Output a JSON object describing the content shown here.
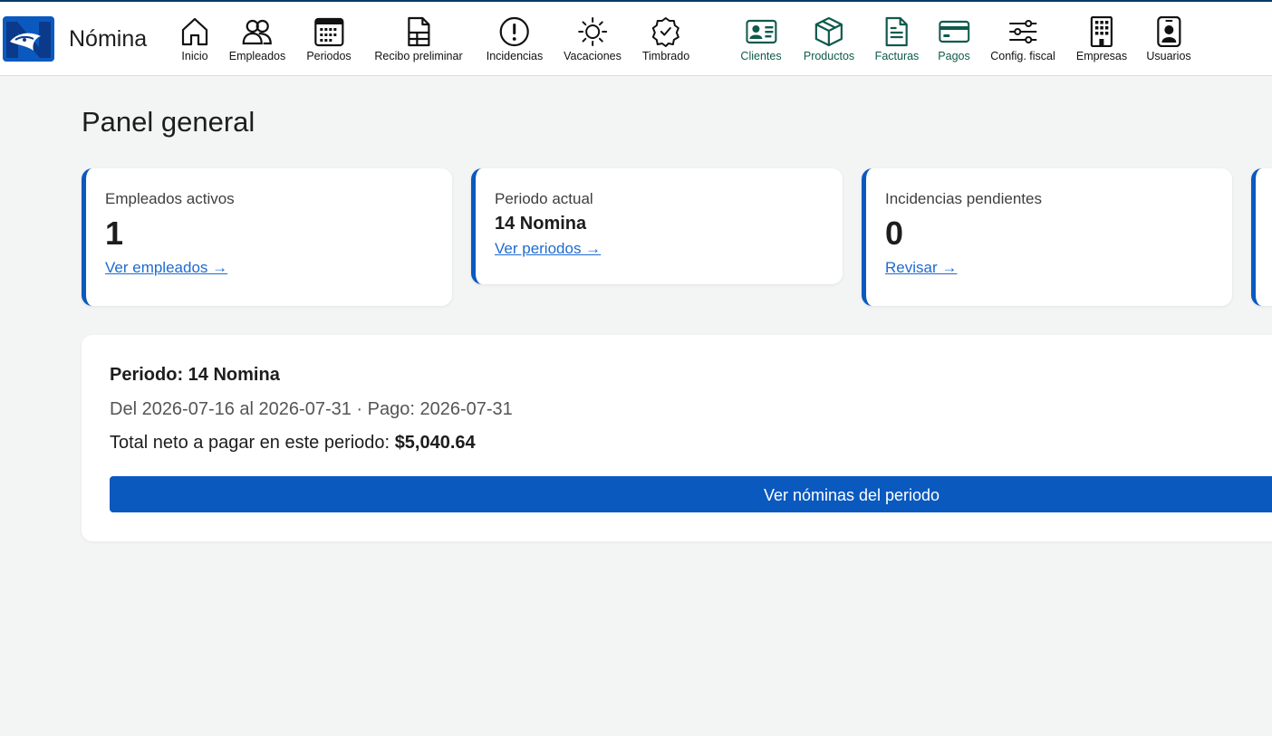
{
  "header": {
    "brand": "Nómina",
    "nav": [
      {
        "label": "Inicio",
        "icon": "home-icon"
      },
      {
        "label": "Empleados",
        "icon": "people-icon"
      },
      {
        "label": "Periodos",
        "icon": "calendar-icon"
      },
      {
        "label": "Recibo preliminar",
        "icon": "document-table-icon"
      },
      {
        "label": "Incidencias",
        "icon": "exclamation-circle-icon"
      },
      {
        "label": "Vacaciones",
        "icon": "sun-icon"
      },
      {
        "label": "Timbrado",
        "icon": "badge-check-icon"
      },
      {
        "label": "Clientes",
        "icon": "id-card-icon"
      },
      {
        "label": "Productos",
        "icon": "box-icon"
      },
      {
        "label": "Facturas",
        "icon": "invoice-icon"
      },
      {
        "label": "Pagos",
        "icon": "credit-card-icon"
      },
      {
        "label": "Config. fiscal",
        "icon": "sliders-icon"
      },
      {
        "label": "Empresas",
        "icon": "building-icon"
      },
      {
        "label": "Usuarios",
        "icon": "user-badge-icon"
      }
    ]
  },
  "page": {
    "title": "Panel general"
  },
  "cards": {
    "employees": {
      "label": "Empleados activos",
      "value": "1",
      "link": "Ver empleados →"
    },
    "period": {
      "label": "Periodo actual",
      "value": "14 Nomina",
      "link": "Ver periodos →"
    },
    "incidents": {
      "label": "Incidencias pendientes",
      "value": "0",
      "link": "Revisar →"
    }
  },
  "period_panel": {
    "title": "Periodo: 14 Nomina",
    "dates": "Del 2026-07-16 al 2026-07-31 · Pago: 2026-07-31",
    "total_label": "Total neto a pagar en este periodo:",
    "total_value": "$5,040.64",
    "button": "Ver nóminas del periodo"
  },
  "colors": {
    "accent": "#0a59bf",
    "nav_green": "#0f5a4c",
    "link": "#1f6bd1"
  }
}
